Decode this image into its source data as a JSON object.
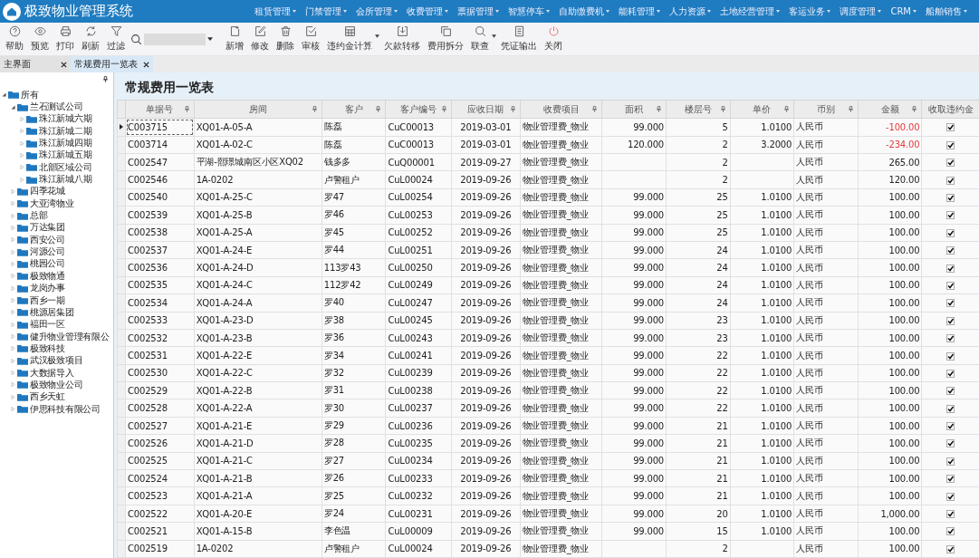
{
  "app": {
    "title": "极致物业管理系统"
  },
  "menu": [
    "租赁管理",
    "门禁管理",
    "会所管理",
    "收费管理",
    "票据管理",
    "智慧停车",
    "自助缴费机",
    "能耗管理",
    "人力资源",
    "土地经营管理",
    "客运业务",
    "调度管理",
    "CRM",
    "船舶销售"
  ],
  "toolbar_left": [
    {
      "label": "帮助"
    },
    {
      "label": "预览"
    },
    {
      "label": "打印"
    },
    {
      "label": "刷新"
    },
    {
      "label": "过滤"
    }
  ],
  "toolbar_right": [
    {
      "label": "新增",
      "dropdown": false
    },
    {
      "label": "修改",
      "dropdown": false
    },
    {
      "label": "删除",
      "dropdown": false
    },
    {
      "label": "审核",
      "dropdown": false
    },
    {
      "label": "违约金计算",
      "dropdown": true
    },
    {
      "label": "欠款转移",
      "dropdown": false
    },
    {
      "label": "费用拆分",
      "dropdown": false
    },
    {
      "label": "联查",
      "dropdown": true
    },
    {
      "label": "凭证输出",
      "dropdown": false
    },
    {
      "label": "关闭",
      "dropdown": false
    }
  ],
  "tabs": [
    {
      "label": "主界面",
      "selected": false
    },
    {
      "label": "常规费用一览表",
      "selected": true
    }
  ],
  "tree": [
    {
      "label": "所有",
      "expanded": true,
      "children": [
        {
          "label": "兰石测试公司",
          "expanded": true,
          "children": [
            {
              "label": "珠江新城六期",
              "expanded": false
            },
            {
              "label": "珠江新城二期",
              "expanded": false
            },
            {
              "label": "珠江新城四期",
              "expanded": false
            },
            {
              "label": "珠江新城五期",
              "expanded": false
            },
            {
              "label": "北部区域公司",
              "expanded": false
            },
            {
              "label": "珠江新城八期",
              "expanded": false
            }
          ]
        },
        {
          "label": "四季花城",
          "expanded": false
        },
        {
          "label": "大亚湾物业",
          "expanded": false
        },
        {
          "label": "总部",
          "expanded": false
        },
        {
          "label": "万达集团",
          "expanded": false
        },
        {
          "label": "西安公司",
          "expanded": false
        },
        {
          "label": "河源公司",
          "expanded": false
        },
        {
          "label": "桃园公司",
          "expanded": false
        },
        {
          "label": "极致物通",
          "expanded": false
        },
        {
          "label": "龙岗办事",
          "expanded": false
        },
        {
          "label": "西乡一期",
          "expanded": false
        },
        {
          "label": "桃源居集团",
          "expanded": false
        },
        {
          "label": "福田一区",
          "expanded": false
        },
        {
          "label": "健升物业管理有限公",
          "expanded": false
        },
        {
          "label": "极致科技",
          "expanded": false
        },
        {
          "label": "武汉极致项目",
          "expanded": false
        },
        {
          "label": "大数据导入",
          "expanded": false
        },
        {
          "label": "极致物业公司",
          "expanded": false
        },
        {
          "label": "西乡天虹",
          "expanded": false
        },
        {
          "label": "伊思科技有限公司",
          "expanded": false
        }
      ]
    }
  ],
  "page_title": "常规费用一览表",
  "columns": [
    {
      "label": "单据号",
      "filter": true
    },
    {
      "label": "房间",
      "filter": true
    },
    {
      "label": "客户",
      "filter": true
    },
    {
      "label": "客户编号",
      "filter": true
    },
    {
      "label": "应收日期",
      "filter": true
    },
    {
      "label": "收费项目",
      "filter": true
    },
    {
      "label": "面积",
      "filter": true
    },
    {
      "label": "楼层号",
      "filter": true
    },
    {
      "label": "单价",
      "filter": true
    },
    {
      "label": "币别",
      "filter": true
    },
    {
      "label": "金额",
      "filter": true
    },
    {
      "label": "收取违约金",
      "filter": false
    }
  ],
  "rows": [
    {
      "selected": true,
      "cells": [
        "C003715",
        "XQ01-A-05-A",
        "陈磊",
        "CuC00013",
        "2019-03-01",
        "物业管理费_物业",
        "99.000",
        "5",
        "1.0100",
        "人民币",
        "-100.00"
      ],
      "negative": true,
      "penalty": true
    },
    {
      "selected": false,
      "cells": [
        "C003714",
        "XQ01-A-02-C",
        "陈磊",
        "CuC00013",
        "2019-03-01",
        "物业管理费_物业",
        "120.000",
        "2",
        "3.2000",
        "人民币",
        "-234.00"
      ],
      "negative": true,
      "penalty": true
    },
    {
      "selected": false,
      "cells": [
        "C002547",
        "平湖-熙璟城南区小区XQ02",
        "钱多多",
        "CuQ00001",
        "2019-09-27",
        "物业管理费_物业",
        "",
        "2",
        "",
        "人民币",
        "265.00"
      ],
      "negative": false,
      "penalty": true
    },
    {
      "selected": false,
      "cells": [
        "C002546",
        "1A-0202",
        "卢警租户",
        "CuL00024",
        "2019-09-26",
        "物业管理费_物业",
        "",
        "2",
        "",
        "人民币",
        "120.00"
      ],
      "negative": false,
      "penalty": true
    },
    {
      "selected": false,
      "cells": [
        "C002540",
        "XQ01-A-25-C",
        "罗47",
        "CuL00254",
        "2019-09-26",
        "物业管理费_物业",
        "99.000",
        "25",
        "1.0100",
        "人民币",
        "100.00"
      ],
      "negative": false,
      "penalty": true
    },
    {
      "selected": false,
      "cells": [
        "C002539",
        "XQ01-A-25-B",
        "罗46",
        "CuL00253",
        "2019-09-26",
        "物业管理费_物业",
        "99.000",
        "25",
        "1.0100",
        "人民币",
        "100.00"
      ],
      "negative": false,
      "penalty": true
    },
    {
      "selected": false,
      "cells": [
        "C002538",
        "XQ01-A-25-A",
        "罗45",
        "CuL00252",
        "2019-09-26",
        "物业管理费_物业",
        "99.000",
        "25",
        "1.0100",
        "人民币",
        "100.00"
      ],
      "negative": false,
      "penalty": true
    },
    {
      "selected": false,
      "cells": [
        "C002537",
        "XQ01-A-24-E",
        "罗44",
        "CuL00251",
        "2019-09-26",
        "物业管理费_物业",
        "99.000",
        "24",
        "1.0100",
        "人民币",
        "100.00"
      ],
      "negative": false,
      "penalty": true
    },
    {
      "selected": false,
      "cells": [
        "C002536",
        "XQ01-A-24-D",
        "113罗43",
        "CuL00250",
        "2019-09-26",
        "物业管理费_物业",
        "99.000",
        "24",
        "1.0100",
        "人民币",
        "100.00"
      ],
      "negative": false,
      "penalty": true
    },
    {
      "selected": false,
      "cells": [
        "C002535",
        "XQ01-A-24-C",
        "112罗42",
        "CuL00249",
        "2019-09-26",
        "物业管理费_物业",
        "99.000",
        "24",
        "1.0100",
        "人民币",
        "100.00"
      ],
      "negative": false,
      "penalty": true
    },
    {
      "selected": false,
      "cells": [
        "C002534",
        "XQ01-A-24-A",
        "罗40",
        "CuL00247",
        "2019-09-26",
        "物业管理费_物业",
        "99.000",
        "24",
        "1.0100",
        "人民币",
        "100.00"
      ],
      "negative": false,
      "penalty": true
    },
    {
      "selected": false,
      "cells": [
        "C002533",
        "XQ01-A-23-D",
        "罗38",
        "CuL00245",
        "2019-09-26",
        "物业管理费_物业",
        "99.000",
        "23",
        "1.0100",
        "人民币",
        "100.00"
      ],
      "negative": false,
      "penalty": true
    },
    {
      "selected": false,
      "cells": [
        "C002532",
        "XQ01-A-23-B",
        "罗36",
        "CuL00243",
        "2019-09-26",
        "物业管理费_物业",
        "99.000",
        "23",
        "1.0100",
        "人民币",
        "100.00"
      ],
      "negative": false,
      "penalty": true
    },
    {
      "selected": false,
      "cells": [
        "C002531",
        "XQ01-A-22-E",
        "罗34",
        "CuL00241",
        "2019-09-26",
        "物业管理费_物业",
        "99.000",
        "22",
        "1.0100",
        "人民币",
        "100.00"
      ],
      "negative": false,
      "penalty": true
    },
    {
      "selected": false,
      "cells": [
        "C002530",
        "XQ01-A-22-C",
        "罗32",
        "CuL00239",
        "2019-09-26",
        "物业管理费_物业",
        "99.000",
        "22",
        "1.0100",
        "人民币",
        "100.00"
      ],
      "negative": false,
      "penalty": true
    },
    {
      "selected": false,
      "cells": [
        "C002529",
        "XQ01-A-22-B",
        "罗31",
        "CuL00238",
        "2019-09-26",
        "物业管理费_物业",
        "99.000",
        "22",
        "1.0100",
        "人民币",
        "100.00"
      ],
      "negative": false,
      "penalty": true
    },
    {
      "selected": false,
      "cells": [
        "C002528",
        "XQ01-A-22-A",
        "罗30",
        "CuL00237",
        "2019-09-26",
        "物业管理费_物业",
        "99.000",
        "22",
        "1.0100",
        "人民币",
        "100.00"
      ],
      "negative": false,
      "penalty": true
    },
    {
      "selected": false,
      "cells": [
        "C002527",
        "XQ01-A-21-E",
        "罗29",
        "CuL00236",
        "2019-09-26",
        "物业管理费_物业",
        "99.000",
        "21",
        "1.0100",
        "人民币",
        "100.00"
      ],
      "negative": false,
      "penalty": true
    },
    {
      "selected": false,
      "cells": [
        "C002526",
        "XQ01-A-21-D",
        "罗28",
        "CuL00235",
        "2019-09-26",
        "物业管理费_物业",
        "99.000",
        "21",
        "1.0100",
        "人民币",
        "100.00"
      ],
      "negative": false,
      "penalty": true
    },
    {
      "selected": false,
      "cells": [
        "C002525",
        "XQ01-A-21-C",
        "罗27",
        "CuL00234",
        "2019-09-26",
        "物业管理费_物业",
        "99.000",
        "21",
        "1.0100",
        "人民币",
        "100.00"
      ],
      "negative": false,
      "penalty": true
    },
    {
      "selected": false,
      "cells": [
        "C002524",
        "XQ01-A-21-B",
        "罗26",
        "CuL00233",
        "2019-09-26",
        "物业管理费_物业",
        "99.000",
        "21",
        "1.0100",
        "人民币",
        "100.00"
      ],
      "negative": false,
      "penalty": true
    },
    {
      "selected": false,
      "cells": [
        "C002523",
        "XQ01-A-21-A",
        "罗25",
        "CuL00232",
        "2019-09-26",
        "物业管理费_物业",
        "99.000",
        "21",
        "1.0100",
        "人民币",
        "100.00"
      ],
      "negative": false,
      "penalty": true
    },
    {
      "selected": false,
      "cells": [
        "C002522",
        "XQ01-A-20-E",
        "罗24",
        "CuL00231",
        "2019-09-26",
        "物业管理费_物业",
        "99.000",
        "20",
        "1.0100",
        "人民币",
        "1,000.00"
      ],
      "negative": false,
      "penalty": true
    },
    {
      "selected": false,
      "cells": [
        "C002521",
        "XQ01-A-15-B",
        "李色温",
        "CuL00009",
        "2019-09-26",
        "物业管理费_物业",
        "99.000",
        "15",
        "1.0100",
        "人民币",
        "100.00"
      ],
      "negative": false,
      "penalty": true
    },
    {
      "selected": false,
      "cells": [
        "C002519",
        "1A-0202",
        "卢警租户",
        "CuL00024",
        "2019-09-26",
        "物业管理费_物业",
        "",
        "2",
        "",
        "人民币",
        "100.00"
      ],
      "negative": false,
      "penalty": true
    }
  ]
}
